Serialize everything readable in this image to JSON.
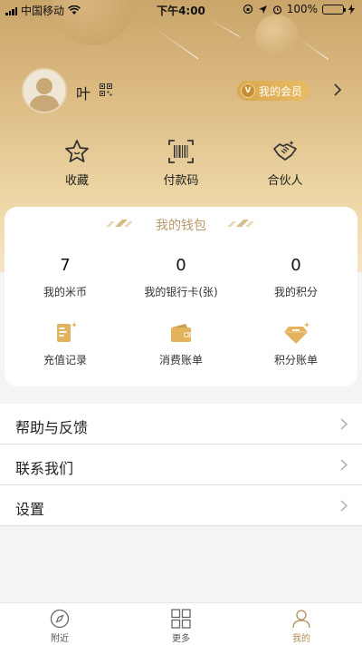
{
  "status_bar": {
    "carrier": "中国移动",
    "time": "下午4:00",
    "battery": "100%"
  },
  "profile": {
    "name": "叶",
    "member_label": "我的会员"
  },
  "quick_actions": [
    {
      "label": "收藏",
      "icon": "star-icon"
    },
    {
      "label": "付款码",
      "icon": "barcode-scan-icon"
    },
    {
      "label": "合伙人",
      "icon": "handshake-icon"
    }
  ],
  "wallet": {
    "title": "我的钱包",
    "stats": [
      {
        "value": "7",
        "label": "我的米币"
      },
      {
        "value": "0",
        "label": "我的银行卡(张)"
      },
      {
        "value": "0",
        "label": "我的积分"
      }
    ],
    "tools": [
      {
        "label": "充值记录",
        "icon": "recharge-record-icon"
      },
      {
        "label": "消费账单",
        "icon": "wallet-icon"
      },
      {
        "label": "积分账单",
        "icon": "diamond-icon"
      }
    ]
  },
  "menu": [
    {
      "label": "帮助与反馈"
    },
    {
      "label": "联系我们"
    },
    {
      "label": "设置"
    }
  ],
  "tabbar": [
    {
      "label": "附近",
      "icon": "compass-icon",
      "active": false
    },
    {
      "label": "更多",
      "icon": "grid-icon",
      "active": false
    },
    {
      "label": "我的",
      "icon": "person-icon",
      "active": true
    }
  ],
  "colors": {
    "gold_accent": "#d9a74f",
    "header_top": "#c9a56a",
    "header_bottom": "#f4e6c5",
    "wallet_title": "#b89a6b",
    "tab_active": "#b08d55"
  }
}
